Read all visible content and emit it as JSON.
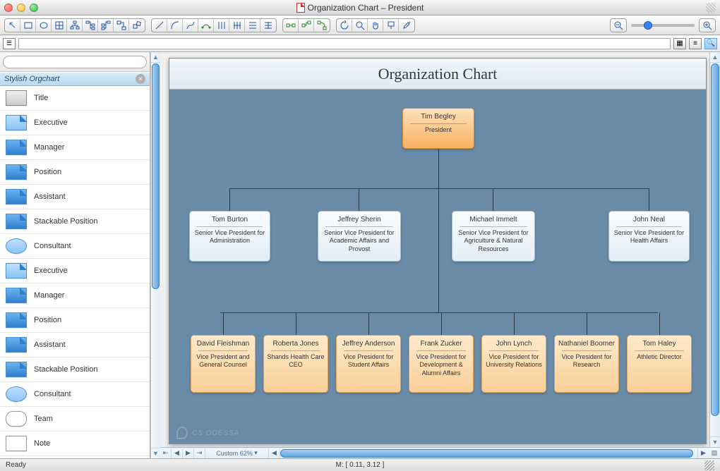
{
  "window": {
    "title": "Organization Chart – President"
  },
  "toolbar": {
    "groups": [
      [
        "pointer",
        "rect",
        "ellipse",
        "table",
        "tree1",
        "tree2",
        "tree3",
        "swap",
        "rotate"
      ],
      [
        "line1",
        "line2",
        "line3",
        "curve",
        "conn1",
        "conn2",
        "conn3",
        "conn4"
      ],
      [
        "side1",
        "side2",
        "side3"
      ],
      [
        "refresh",
        "zoom-mag",
        "hand",
        "apply",
        "eyedropper"
      ]
    ],
    "zoom": {
      "out": "−",
      "in": "+"
    }
  },
  "sidebar": {
    "category": "Stylish Orgchart",
    "items": [
      {
        "label": "Title",
        "swatch": "title"
      },
      {
        "label": "Executive",
        "swatch": "light"
      },
      {
        "label": "Manager",
        "swatch": "dark"
      },
      {
        "label": "Position",
        "swatch": "dark"
      },
      {
        "label": "Assistant",
        "swatch": "dark"
      },
      {
        "label": "Stackable Position",
        "swatch": "dark"
      },
      {
        "label": "Consultant",
        "swatch": "oval"
      },
      {
        "label": "Executive",
        "swatch": "light"
      },
      {
        "label": "Manager",
        "swatch": "dark"
      },
      {
        "label": "Position",
        "swatch": "dark"
      },
      {
        "label": "Assistant",
        "swatch": "dark"
      },
      {
        "label": "Stackable Position",
        "swatch": "dark"
      },
      {
        "label": "Consultant",
        "swatch": "oval"
      },
      {
        "label": "Team",
        "swatch": "white round"
      },
      {
        "label": "Note",
        "swatch": "white"
      }
    ]
  },
  "chart_data": {
    "type": "org-chart",
    "title": "Organization Chart",
    "root": {
      "name": "Tim Begley",
      "role": "President",
      "style": "orange"
    },
    "level2": [
      {
        "name": "Tom Burton",
        "role": "Senior Vice President for Administration"
      },
      {
        "name": "Jeffrey Sherin",
        "role": "Senior Vice President for Academic Affairs and Provost"
      },
      {
        "name": "Michael Immelt",
        "role": "Senior Vice President for Agriculture & Natural Resources"
      },
      {
        "name": "John Neal",
        "role": "Senior Vice President for Health Affairs"
      }
    ],
    "level3": [
      {
        "name": "David Fleishman",
        "role": "Vice President and General Counsel"
      },
      {
        "name": "Roberta Jones",
        "role": "Shands Health Care CEO"
      },
      {
        "name": "Jeffrey Anderson",
        "role": "Vice President for Student Affairs"
      },
      {
        "name": "Frank Zucker",
        "role": "Vice President for Development & Alumni Affairs"
      },
      {
        "name": "John Lynch",
        "role": "Vice President for University Relations"
      },
      {
        "name": "Nathaniel Boomer",
        "role": "Vice President for Research"
      },
      {
        "name": "Tom Haley",
        "role": "Athletic Director"
      }
    ],
    "watermark": "CS ODESSA"
  },
  "footer": {
    "zoom_label": "Custom 62%",
    "status": "Ready",
    "mouse": "M: [ 0.11, 3.12 ]"
  }
}
